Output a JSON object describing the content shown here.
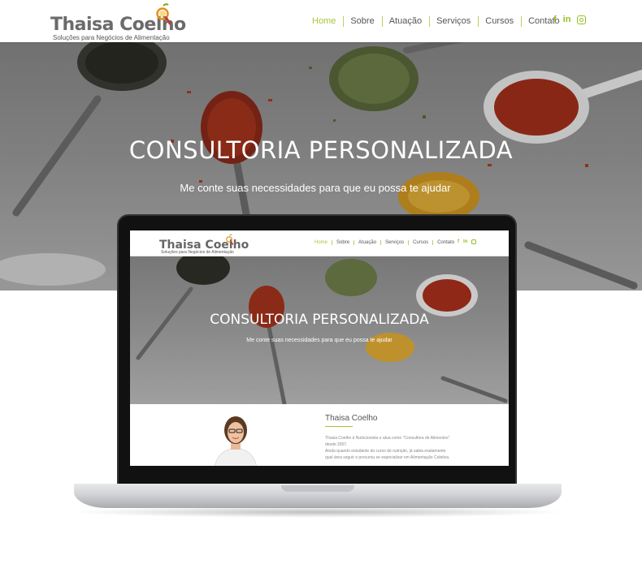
{
  "brand": {
    "name": "Thaisa Coelho",
    "tagline": "Soluções para Negócios de Alimentação"
  },
  "nav": {
    "items": [
      "Home",
      "Sobre",
      "Atuação",
      "Serviços",
      "Cursos",
      "Contato"
    ],
    "active": "Home"
  },
  "social": {
    "facebook": "f",
    "linkedin": "in",
    "instagram_icon": "instagram-icon"
  },
  "hero": {
    "title": "CONSULTORIA PERSONALIZADA",
    "subtitle": "Me conte suas necessidades para que eu possa te ajudar"
  },
  "laptop_preview": {
    "about_title": "Thaisa Coelho",
    "about_text": [
      "Thaisa Coelho é Nutricionista e atua como \"Consultora de Alimentos\"",
      "desde 2007.",
      "Ainda quando estudante do curso de nutrição, já sabia exatamente",
      "qual área seguir e procurou se especializar em Alimentação Coletiva."
    ]
  },
  "colors": {
    "accent": "#a5c73b",
    "social": "#93c01f",
    "text": "#555555"
  }
}
